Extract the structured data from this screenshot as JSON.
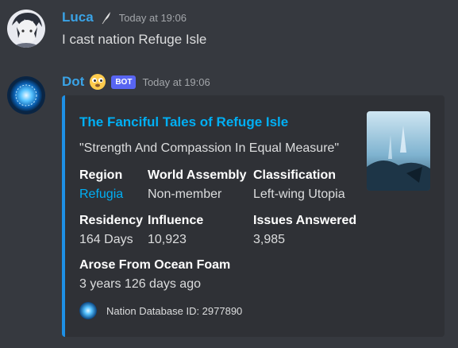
{
  "messages": [
    {
      "author": "Luca",
      "author_color": "#3aa3e6",
      "timestamp": "Today at 19:06",
      "content": "I cast nation Refuge Isle"
    },
    {
      "author": "Dot",
      "author_color": "#3aa3e6",
      "bot_badge": "BOT",
      "timestamp": "Today at 19:06",
      "embed": {
        "accent_color": "#1e90e6",
        "title": "The Fanciful Tales of Refuge Isle",
        "description": "\"Strength And Compassion In Equal Measure\"",
        "fields": {
          "region": {
            "name": "Region",
            "value": "Refugia"
          },
          "world_assembly": {
            "name": "World Assembly",
            "value": "Non-member"
          },
          "classification": {
            "name": "Classification",
            "value": "Left-wing Utopia"
          },
          "residency": {
            "name": "Residency",
            "value": "164 Days"
          },
          "influence": {
            "name": "Influence",
            "value": "10,923"
          },
          "issues_answered": {
            "name": "Issues Answered",
            "value": "3,985"
          },
          "arose": {
            "name": "Arose From Ocean Foam",
            "value": "3 years 126 days ago"
          }
        },
        "footer": "Nation Database ID: 2977890"
      }
    }
  ]
}
